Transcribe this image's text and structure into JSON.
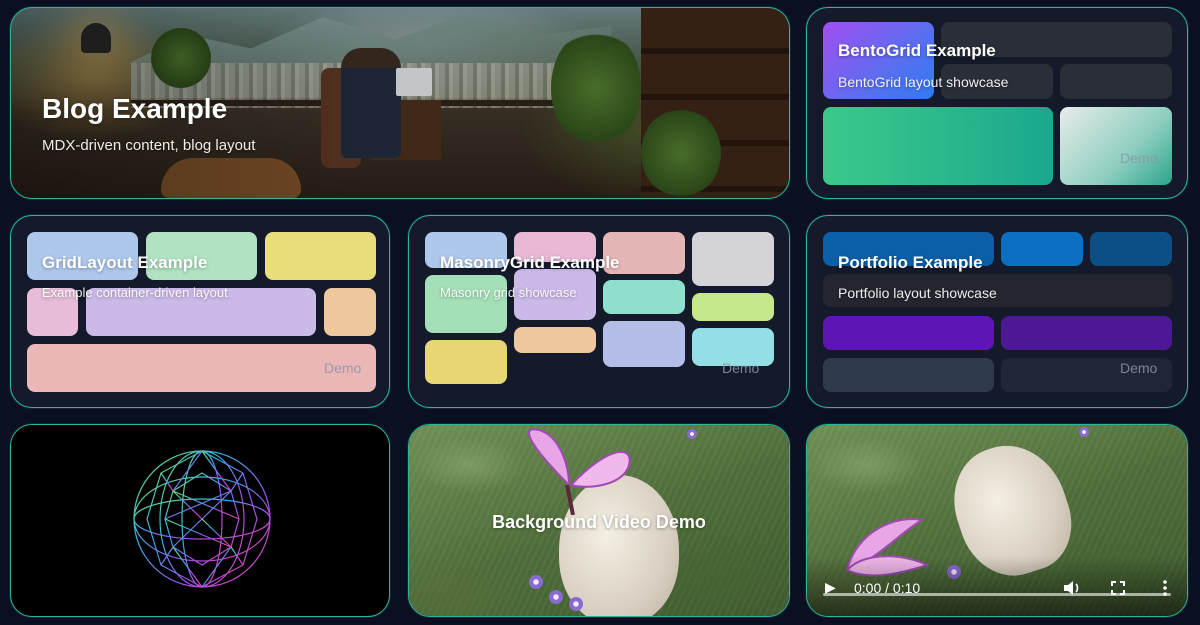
{
  "cards": {
    "blog": {
      "title": "Blog Example",
      "subtitle": "MDX-driven content, blog layout"
    },
    "bento": {
      "title": "BentoGrid Example",
      "subtitle": "BentoGrid layout showcase",
      "demo": "Demo"
    },
    "grid": {
      "title": "GridLayout Example",
      "subtitle": "Example container-driven layout",
      "demo": "Demo"
    },
    "masonry": {
      "title": "MasonryGrid Example",
      "subtitle": "Masonry grid showcase",
      "demo": "Demo"
    },
    "portfolio": {
      "title": "Portfolio Example",
      "subtitle": "Portfolio layout showcase",
      "demo": "Demo"
    },
    "sphere": {
      "title": ""
    },
    "bgvideo": {
      "title": "Background Video Demo"
    },
    "player": {
      "time": "0:00 / 0:10"
    }
  },
  "icons": {
    "play": "play-icon",
    "volume": "volume-icon",
    "fullscreen": "fullscreen-icon",
    "more": "more-vertical-icon"
  },
  "colors": {
    "border": "#2fb59a",
    "background": "#0b1020",
    "card": "#141a2a"
  },
  "video": {
    "progress": 0
  }
}
